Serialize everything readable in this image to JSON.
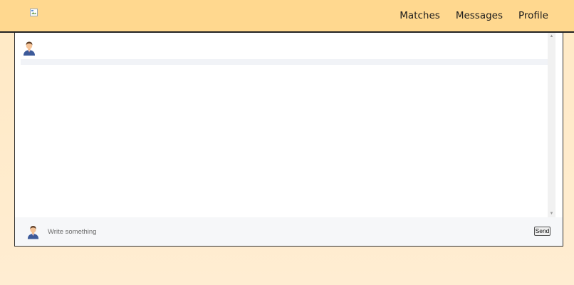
{
  "header": {
    "nav": [
      {
        "label": "Matches"
      },
      {
        "label": "Messages"
      },
      {
        "label": "Profile"
      }
    ]
  },
  "chat": {
    "avatar_icon": "user-avatar-icon",
    "composer": {
      "placeholder": "Write something",
      "send_label": "Send"
    }
  },
  "colors": {
    "header_bg": "#ffd88f",
    "page_bg": "#ffeacb",
    "panel_bg": "#ffffff",
    "composer_bg": "#f6f7f9"
  }
}
